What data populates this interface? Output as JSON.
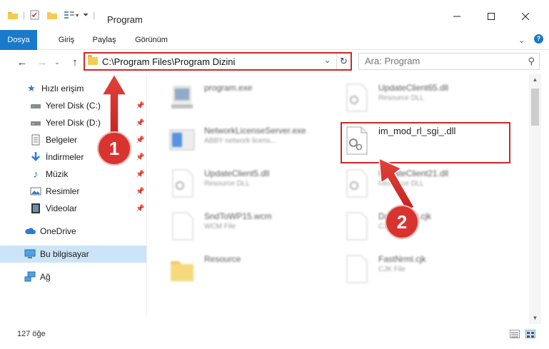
{
  "window": {
    "title": "Program"
  },
  "ribbon": {
    "tabs": [
      "Dosya",
      "Giriş",
      "Paylaş",
      "Görünüm"
    ]
  },
  "address": {
    "path": "C:\\Program Files\\Program Dizini"
  },
  "search": {
    "placeholder": "Ara: Program"
  },
  "sidebar": {
    "items": [
      {
        "label": "Hızlı erişim",
        "icon": "star-icon"
      },
      {
        "label": "Yerel Disk (C:)",
        "icon": "drive-icon"
      },
      {
        "label": "Yerel Disk (D:)",
        "icon": "drive-icon"
      },
      {
        "label": "Belgeler",
        "icon": "documents-icon"
      },
      {
        "label": "İndirmeler",
        "icon": "download-icon"
      },
      {
        "label": "Müzik",
        "icon": "music-icon"
      },
      {
        "label": "Resimler",
        "icon": "pictures-icon"
      },
      {
        "label": "Videolar",
        "icon": "videos-icon"
      },
      {
        "label": "OneDrive",
        "icon": "cloud-icon"
      },
      {
        "label": "Bu bilgisayar",
        "icon": "computer-icon"
      },
      {
        "label": "Ağ",
        "icon": "network-icon"
      }
    ]
  },
  "files": [
    {
      "name": "program.exe",
      "type": ""
    },
    {
      "name": "UpdateClient65.dll",
      "type": "Resource DLL"
    },
    {
      "name": "NetworkLicenseServer.exe",
      "type": "ABBY network licens..."
    },
    {
      "name": "im_mod_rl_sgi_.dll",
      "type": ""
    },
    {
      "name": "UpdateClient5.dll",
      "type": "Resource DLL"
    },
    {
      "name": "UpdateClient21.dll",
      "type": "Resource DLL"
    },
    {
      "name": "SndToWP15.wcm",
      "type": "WCM File"
    },
    {
      "name": "DataClient.cjk",
      "type": "CJK File"
    },
    {
      "name": "Resource",
      "type": ""
    },
    {
      "name": "FastNrml.cjk",
      "type": "CJK File"
    }
  ],
  "status": {
    "count": "127 öğe"
  },
  "annotations": {
    "badge1": "1",
    "badge2": "2",
    "accent": "#d9332f"
  }
}
